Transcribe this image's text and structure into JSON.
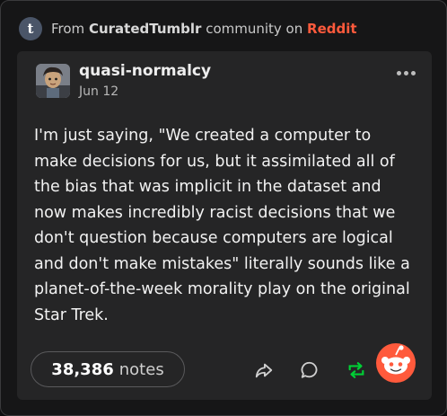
{
  "source": {
    "prefix": "From",
    "community": "CuratedTumblr",
    "middle": "community on",
    "platform": "Reddit",
    "badge_letter": "t",
    "badge_icon": "tumblr-icon"
  },
  "post": {
    "username": "quasi-normalcy",
    "date": "Jun 12",
    "avatar_icon": "avatar-image",
    "menu_icon": "more-options-icon",
    "body": "I'm just saying, \"We created a computer to make decisions for us, but it assimilated all of the bias that was implicit in the dataset and now makes incredibly racist decisions that we don't question because computers are logical and don't make mistakes\" literally sounds like a planet-of-the-week morality play on the original Star Trek."
  },
  "footer": {
    "notes_count": "38,386",
    "notes_label": "notes",
    "actions": [
      "share-icon",
      "reply-icon",
      "reblog-icon"
    ]
  },
  "colors": {
    "background": "#161617",
    "card": "#252526",
    "reddit_accent": "#ff5a3c",
    "reblog_green": "#00cf35"
  }
}
